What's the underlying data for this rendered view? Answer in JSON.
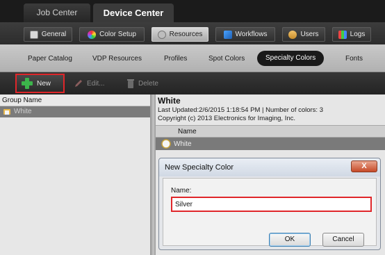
{
  "top_tabs": [
    {
      "label": "Job Center"
    },
    {
      "label": "Device Center"
    }
  ],
  "section_tabs": [
    {
      "label": "General",
      "icon": "printer-icon"
    },
    {
      "label": "Color Setup",
      "icon": "color-wheel-icon"
    },
    {
      "label": "Resources",
      "icon": "resources-icon"
    },
    {
      "label": "Workflows",
      "icon": "workflow-icon"
    },
    {
      "label": "Users",
      "icon": "users-icon"
    },
    {
      "label": "Logs",
      "icon": "logs-icon"
    }
  ],
  "sub_tabs": [
    {
      "label": "Paper Catalog"
    },
    {
      "label": "VDP Resources"
    },
    {
      "label": "Profiles"
    },
    {
      "label": "Spot Colors"
    },
    {
      "label": "Specialty Colors"
    },
    {
      "label": "Fonts"
    }
  ],
  "toolbar": {
    "new_label": "New",
    "edit_label": "Edit...",
    "delete_label": "Delete"
  },
  "left_pane": {
    "header": "Group Name",
    "rows": [
      {
        "label": "White"
      }
    ]
  },
  "right_pane": {
    "title": "White",
    "last_updated": "Last Updated:2/6/2015 1:18:54 PM | Number of colors: 3",
    "copyright": "Copyright (c) 2013 Electronics for Imaging, Inc.",
    "column_header": "Name",
    "rows": [
      {
        "label": "White"
      }
    ]
  },
  "dialog": {
    "title": "New Specialty Color",
    "close_label": "X",
    "name_label": "Name:",
    "name_value": "Silver",
    "ok_label": "OK",
    "cancel_label": "Cancel"
  },
  "colors": {
    "highlight_red": "#e0262a",
    "new_plus_green": "#3cb44b",
    "active_pill": "#1a1a1a"
  }
}
